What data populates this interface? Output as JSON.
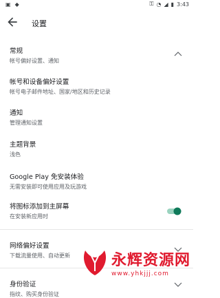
{
  "status": {
    "time": "3:43",
    "icons": [
      "image-icon",
      "android-icon",
      "key-icon",
      "wifi-icon",
      "signal-icon",
      "battery-icon"
    ]
  },
  "appbar": {
    "title": "设置"
  },
  "sections": [
    {
      "title": "常规",
      "subtitle": "帐号偏好设置、通知"
    },
    {
      "title": "帐号和设备偏好设置",
      "subtitle": "帐号电子邮件地址、国家/地区和历史记录"
    },
    {
      "title": "通知",
      "subtitle": "管理通知设置"
    },
    {
      "title": "主题背景",
      "subtitle": "浅色"
    },
    {
      "title": "Google Play 免安装体验",
      "subtitle": "无需安装即可使用应用及玩游戏"
    },
    {
      "title": "将图标添加到主屏幕",
      "subtitle": "在安装新应用时"
    },
    {
      "title": "网络偏好设置",
      "subtitle": "下载流量使用、自动更新"
    },
    {
      "title": "身份验证",
      "subtitle": "指纹、购买身份验证"
    }
  ],
  "toggle_on": true,
  "colors": {
    "accent": "#0f7a5a"
  },
  "watermark": {
    "text": "永辉资源网",
    "url": "www.yhkjjj.com"
  }
}
